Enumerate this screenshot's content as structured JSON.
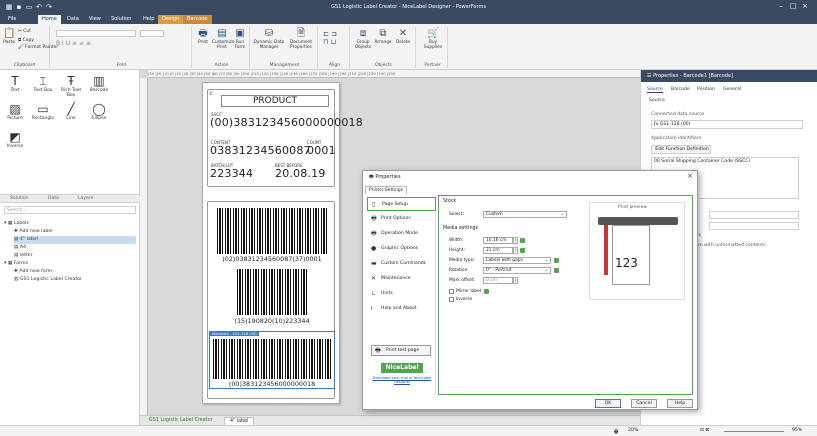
{
  "app": {
    "title": "GS1 Logistic Label Creator - NiceLabel Designer - PowerForms",
    "colors": {
      "chrome": "#3a4a63",
      "accent": "#4fa64f",
      "ribbon_ctx": "#d79a3f"
    }
  },
  "menu": {
    "tabs": [
      "File",
      "Home",
      "Data",
      "View",
      "Solution",
      "Help",
      "Design",
      "Barcode"
    ]
  },
  "ribbon": {
    "clipboard": {
      "label": "Clipboard",
      "paste": "Paste",
      "cut": "Cut",
      "copy": "Copy",
      "format_painter": "Format Painter"
    },
    "font": {
      "label": "Font"
    },
    "action": {
      "label": "Action",
      "print": "Print",
      "customize": "Customize Print",
      "run_form": "Run Form"
    },
    "management": {
      "label": "Management",
      "dynamic_data_manager": "Dynamic Data Manager",
      "document_properties": "Document Properties"
    },
    "align": {
      "label": "Align"
    },
    "objects": {
      "label": "Objects",
      "group": "Group Objects",
      "arrange": "Arrange",
      "delete": "Delete"
    },
    "partner": {
      "label": "Partner",
      "buy_supplies": "Buy Supplies"
    }
  },
  "toolbox": {
    "items": [
      "Text",
      "Text Box",
      "Rich Text Box",
      "Barcode",
      "Picture",
      "Rectangle",
      "Line",
      "Ellipse",
      "Inverse"
    ]
  },
  "solution_panel": {
    "tabs": [
      "Solution",
      "Data",
      "Layers"
    ],
    "search_placeholder": "Search...",
    "tree": [
      "Labels",
      "Add new label",
      "4\" label",
      "A4",
      "letter",
      "Forms",
      "Add new form",
      "GS1 Logistic Label Creator"
    ]
  },
  "label": {
    "product": "PRODUCT",
    "sscc_caption": "SSCC",
    "sscc": "(00)383123456000000018",
    "content_caption": "CONTENT",
    "content": "03831234560087",
    "count_caption": "COUNT",
    "count": "0001",
    "batch_caption": "BATCH/LOT",
    "batch": "223344",
    "best_before_caption": "BEST BEFORE",
    "best_before": "20.08.19",
    "bc1": "(02)03831234560087(37)0001",
    "bc2": "(15)190820(10)223344",
    "bc3": "(00)383123456000000018",
    "selection_tag": "Barcode1 - GS1-128 (00)"
  },
  "ruler": {
    "marks": "|30  |20  |10  |0  |10  |20  |30  |40  |50  |60  |70  |80  |90  |100 |110 |120 |130 |140 |150 |160 |170 |180 |190 |200 |210 |220 |230 |240 |250"
  },
  "doc_tabs": [
    "GS1 Logistic Label Creator",
    "4\" label"
  ],
  "properties_panel": {
    "title": "Properties - Barcode1 [Barcode]",
    "tabs": [
      "Source",
      "Barcode",
      "Position",
      "General"
    ],
    "section": "Source",
    "connected_label": "Connected data source",
    "connected_value": "GS1-128 (00)",
    "app_identifiers": "Application identifiers",
    "edit_button": "Edit Function Definition",
    "ai_item": "00    Serial Shipping Container Code (SSCC)",
    "inputs": "puts",
    "unformatted": "ation with unformatted contents"
  },
  "status": {
    "zoom_left": "20%",
    "zoom_right": "95%"
  },
  "dialog": {
    "title": "Properties",
    "tab": "Printer Settings",
    "nav": [
      "Page Setup",
      "Print Options",
      "Operation Mode",
      "Graphic Options",
      "Custom Commands",
      "Maintenance",
      "Units",
      "Help and About"
    ],
    "print_test_page": "Print test page",
    "brand": "NiceLabel",
    "trial_link": "Download your trial of NiceLabel Designer",
    "stock_heading": "Stock",
    "select_label": "Select:",
    "select_value": "Custom",
    "media_heading": "Media settings",
    "width_label": "Width:",
    "width_value": "10.16 cm",
    "height_label": "Height:",
    "height_value": "21 cm",
    "media_type_label": "Media type:",
    "media_type_value": "Labels with gaps",
    "rotation_label": "Rotation:",
    "rotation_value": "0° - Portrait",
    "mark_offset_label": "Mark offset:",
    "mark_offset_value": "0 cm",
    "mirror_label": "Mirror label",
    "inverse_label": "Inverse",
    "preview_heading": "Print preview",
    "preview_number": "123",
    "ok": "OK",
    "cancel": "Cancel",
    "help": "Help"
  }
}
